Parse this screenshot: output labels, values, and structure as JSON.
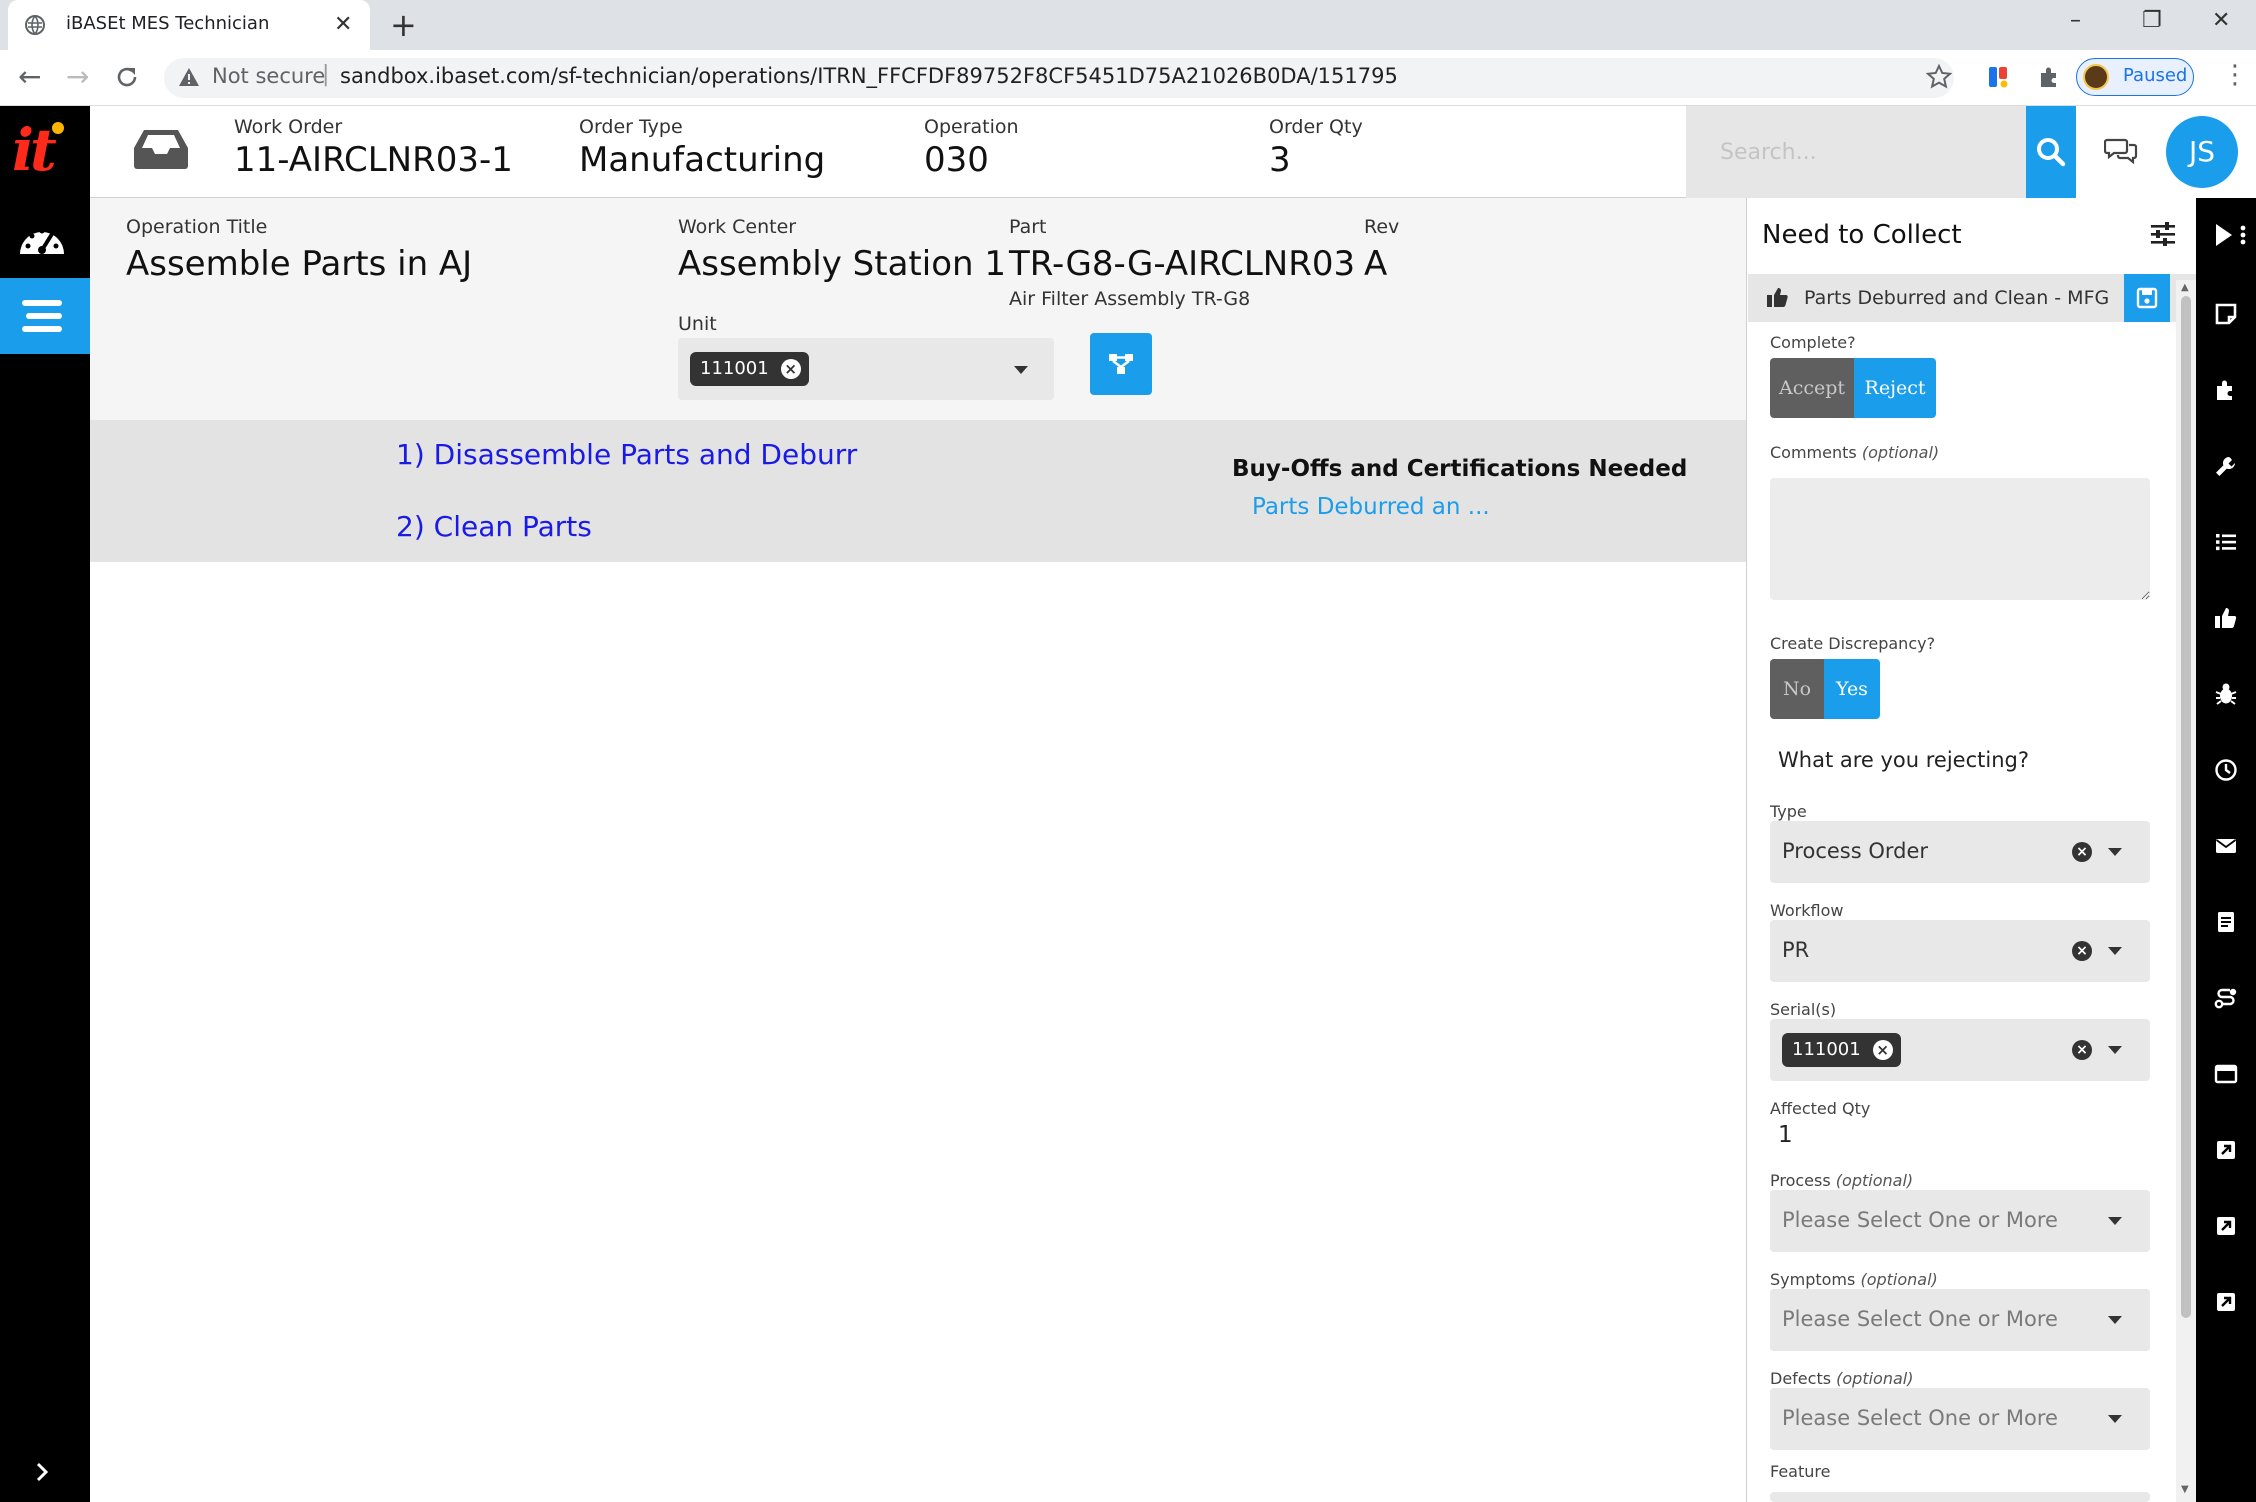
{
  "browser": {
    "tab_title": "iBASEt MES Technician",
    "tab_close": "✕",
    "new_tab": "+",
    "security_label": "Not secure",
    "url_separator": "|",
    "url": "sandbox.ibaset.com/sf-technician/operations/ITRN_FFCFDF89752F8CF5451D75A21026B0DA/151795",
    "profile_status": "Paused",
    "window_controls": [
      "–",
      "❐",
      "✕"
    ],
    "menu": "⋮"
  },
  "app": {
    "logo_text": "it",
    "accent_color": "#1a9dea",
    "logo_color": "#ff2a1a"
  },
  "header": {
    "work_order_label": "Work Order",
    "work_order": "11-AIRCLNR03-1",
    "order_type_label": "Order Type",
    "order_type": "Manufacturing",
    "operation_label": "Operation",
    "operation": "030",
    "order_qty_label": "Order Qty",
    "order_qty": "3",
    "search_placeholder": "Search...",
    "user_initials": "JS"
  },
  "operation": {
    "title_label": "Operation Title",
    "title": "Assemble Parts in AJ",
    "work_center_label": "Work Center",
    "work_center": "Assembly Station 1",
    "part_label": "Part",
    "part": "TR-G8-G-AIRCLNR03",
    "part_description": "Air Filter Assembly TR-G8",
    "rev_label": "Rev",
    "rev": "A",
    "unit_label": "Unit",
    "unit_chip": "111001"
  },
  "steps": [
    {
      "label": "1) Disassemble Parts and Deburr"
    },
    {
      "label": "2) Clean Parts"
    }
  ],
  "buyoffs": {
    "title": "Buy-Offs and Certifications Needed",
    "link": "Parts Deburred an ..."
  },
  "collect_panel": {
    "title": "Need to Collect",
    "item": "Parts Deburred and Clean - MFG",
    "complete_label": "Complete?",
    "accept": "Accept",
    "reject": "Reject",
    "selected_complete": "Reject",
    "comments_label": "Comments",
    "optional": "(optional)",
    "discrepancy_label": "Create Discrepancy?",
    "no": "No",
    "yes": "Yes",
    "selected_discrepancy": "Yes",
    "rejecting_question": "What are you rejecting?",
    "type_label": "Type",
    "type_value": "Process Order",
    "workflow_label": "Workflow",
    "workflow_value": "PR",
    "serials_label": "Serial(s)",
    "serial_chip": "111001",
    "affected_qty_label": "Affected Qty",
    "affected_qty": "1",
    "process_label": "Process",
    "symptoms_label": "Symptoms",
    "defects_label": "Defects",
    "select_placeholder": "Please Select One or More",
    "feature_label": "Feature"
  },
  "right_toolbar": [
    "play-icon",
    "sticky-note-icon",
    "puzzle-icon",
    "wrench-icon",
    "list-icon",
    "thumbs-up-icon",
    "bug-icon",
    "clock-icon",
    "envelope-icon",
    "document-icon",
    "route-icon",
    "window-icon",
    "external-link-icon",
    "external-link-icon",
    "external-link-icon"
  ]
}
